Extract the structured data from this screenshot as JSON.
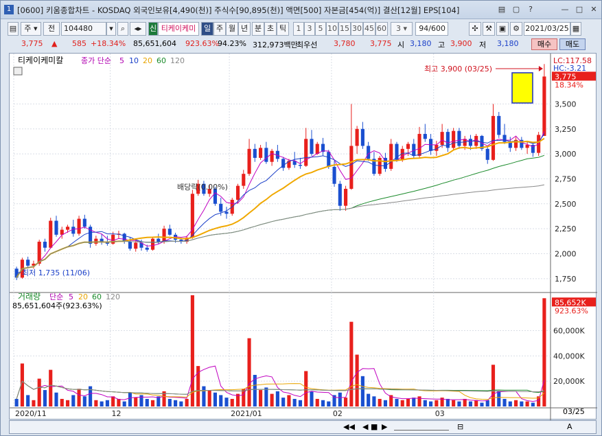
{
  "window": {
    "number": "1",
    "title": "[0600] 키움종합차트 - KOSDAQ 외국인보유[4,490(천)] 주식수[90,895(천)] 액면[500] 자본금[454(억)] 결산[12월] EPS[104]",
    "controls": [
      "▤",
      "▢",
      "?",
      "—",
      "□",
      "✕"
    ]
  },
  "toolbar": {
    "period": "주",
    "mode": "전",
    "code": "104480",
    "new_badge": "신",
    "stock_name": "티케이케미",
    "periods": [
      "일",
      "주",
      "월",
      "년",
      "분",
      "초",
      "틱"
    ],
    "selected_period": "일",
    "intervals": [
      "1",
      "3",
      "5",
      "10",
      "15",
      "30",
      "45",
      "60"
    ],
    "interval_value": "3",
    "count": "94/600",
    "date": "2021/03/25"
  },
  "quote": {
    "price": "3,775",
    "change_arrow": "▲",
    "change": "585",
    "change_pct": "+18.34%",
    "volume": "85,651,604",
    "volume_pct": "923.63%",
    "strength": "94.23%",
    "amount": "312,973백만",
    "priority_label": "최우선",
    "ask": "3,780",
    "bid": "3,775",
    "open_label": "시",
    "open": "3,180",
    "high_label": "고",
    "high": "3,900",
    "low_label": "저",
    "low": "3,180",
    "buy_label": "매수",
    "sell_label": "매도"
  },
  "price_panel": {
    "legend_name": "티케이케미칼",
    "legend_ma_label": "종가 단순",
    "legend_ma": [
      "5",
      "10",
      "20",
      "60",
      "120"
    ],
    "high_annotation": "최고 3,900 (03/25)",
    "low_annotation": "최저 1,735 (11/06)",
    "dividend_annotation": "배당락(0.00%)",
    "lc_label": "LC:117.58",
    "hc_label": "HC:-3.21",
    "last_price_label": "3,775",
    "last_pct_label": "18.34%"
  },
  "volume_panel": {
    "legend_name": "거래량",
    "legend_ma_label": "단순",
    "legend_ma": [
      "5",
      "20",
      "60",
      "120"
    ],
    "last_volume_text": "85,651,604주(923.63%)",
    "last_volume_label": "85,652K",
    "last_pct_label": "923.63%"
  },
  "x_axis_labels": [
    {
      "label": "2020/11",
      "index": 0
    },
    {
      "label": "12",
      "index": 17
    },
    {
      "label": "2021/01",
      "index": 38
    },
    {
      "label": "02",
      "index": 56
    },
    {
      "label": "03",
      "index": 74
    }
  ],
  "x_axis_end_label": "03/25",
  "chart_data": {
    "type": "candlestick",
    "price_axis": {
      "min": 1625,
      "max": 3950,
      "ticks": [
        1750,
        2000,
        2250,
        2500,
        2750,
        3000,
        3250,
        3500
      ]
    },
    "price_tick_labels": [
      "1,750",
      "2,000",
      "2,250",
      "2,500",
      "2,750",
      "3,000",
      "3,250",
      "3,500"
    ],
    "volume_axis": {
      "max": 88000,
      "ticks": [
        20000,
        40000,
        60000
      ]
    },
    "volume_tick_labels": [
      "20,000K",
      "40,000K",
      "60,000K"
    ],
    "ohlc": [
      [
        1850,
        1870,
        1735,
        1760
      ],
      [
        1760,
        1960,
        1750,
        1940
      ],
      [
        1940,
        1970,
        1860,
        1880
      ],
      [
        1880,
        1930,
        1850,
        1900
      ],
      [
        1900,
        2140,
        1880,
        2120
      ],
      [
        2120,
        2150,
        2020,
        2060
      ],
      [
        2060,
        2360,
        2050,
        2330
      ],
      [
        2330,
        2380,
        2170,
        2190
      ],
      [
        2190,
        2270,
        2150,
        2240
      ],
      [
        2240,
        2290,
        2210,
        2270
      ],
      [
        2270,
        2340,
        2170,
        2200
      ],
      [
        2200,
        2380,
        2180,
        2350
      ],
      [
        2350,
        2390,
        2250,
        2270
      ],
      [
        2270,
        2290,
        2060,
        2100
      ],
      [
        2100,
        2180,
        2080,
        2150
      ],
      [
        2150,
        2200,
        2090,
        2120
      ],
      [
        2120,
        2180,
        2080,
        2100
      ],
      [
        2100,
        2220,
        2090,
        2190
      ],
      [
        2190,
        2230,
        2150,
        2200
      ],
      [
        2200,
        2210,
        2100,
        2120
      ],
      [
        2120,
        2160,
        2030,
        2050
      ],
      [
        2050,
        2130,
        2020,
        2110
      ],
      [
        2110,
        2140,
        2030,
        2060
      ],
      [
        2060,
        2090,
        2020,
        2040
      ],
      [
        2040,
        2170,
        2030,
        2150
      ],
      [
        2150,
        2200,
        2100,
        2120
      ],
      [
        2120,
        2280,
        2100,
        2250
      ],
      [
        2250,
        2290,
        2180,
        2190
      ],
      [
        2190,
        2210,
        2110,
        2140
      ],
      [
        2140,
        2160,
        2100,
        2120
      ],
      [
        2120,
        2180,
        2100,
        2160
      ],
      [
        2160,
        2640,
        2150,
        2600
      ],
      [
        2600,
        2740,
        2580,
        2700
      ],
      [
        2700,
        2730,
        2580,
        2600
      ],
      [
        2600,
        2690,
        2570,
        2650
      ],
      [
        2650,
        2670,
        2480,
        2500
      ],
      [
        2500,
        2560,
        2380,
        2420
      ],
      [
        2420,
        2470,
        2350,
        2400
      ],
      [
        2400,
        2560,
        2380,
        2540
      ],
      [
        2540,
        2700,
        2500,
        2680
      ],
      [
        2680,
        2840,
        2650,
        2800
      ],
      [
        2800,
        3150,
        2780,
        3050
      ],
      [
        3050,
        3100,
        2920,
        2960
      ],
      [
        2960,
        3090,
        2940,
        3060
      ],
      [
        3060,
        3120,
        2900,
        2920
      ],
      [
        2920,
        3050,
        2880,
        3030
      ],
      [
        3030,
        3090,
        2920,
        2950
      ],
      [
        2950,
        2970,
        2830,
        2860
      ],
      [
        2860,
        2950,
        2840,
        2930
      ],
      [
        2930,
        3020,
        2860,
        2890
      ],
      [
        2890,
        2960,
        2850,
        2880
      ],
      [
        2880,
        3260,
        2870,
        3150
      ],
      [
        3150,
        3240,
        2980,
        3000
      ],
      [
        3000,
        3120,
        2990,
        3100
      ],
      [
        3100,
        3160,
        2980,
        3020
      ],
      [
        3020,
        3040,
        2850,
        2870
      ],
      [
        2870,
        2930,
        2670,
        2700
      ],
      [
        2700,
        2730,
        2430,
        2480
      ],
      [
        2480,
        2680,
        2430,
        2650
      ],
      [
        2650,
        3500,
        2640,
        3080
      ],
      [
        3080,
        3280,
        3000,
        3250
      ],
      [
        3250,
        3320,
        3050,
        3080
      ],
      [
        3080,
        3120,
        2930,
        2950
      ],
      [
        2950,
        3020,
        2780,
        2800
      ],
      [
        2800,
        2980,
        2780,
        2960
      ],
      [
        2960,
        3010,
        2820,
        2850
      ],
      [
        2850,
        3150,
        2830,
        3100
      ],
      [
        3100,
        3120,
        2920,
        2940
      ],
      [
        2940,
        3080,
        2920,
        3050
      ],
      [
        3050,
        3120,
        2980,
        3100
      ],
      [
        3100,
        3150,
        2960,
        2980
      ],
      [
        2980,
        3270,
        2960,
        3200
      ],
      [
        3200,
        3300,
        3120,
        3150
      ],
      [
        3150,
        3200,
        2990,
        3030
      ],
      [
        3030,
        3130,
        2980,
        3090
      ],
      [
        3090,
        3300,
        3060,
        3220
      ],
      [
        3220,
        3250,
        3020,
        3060
      ],
      [
        3060,
        3260,
        3040,
        3230
      ],
      [
        3230,
        3260,
        3050,
        3080
      ],
      [
        3080,
        3180,
        3040,
        3150
      ],
      [
        3150,
        3190,
        3040,
        3080
      ],
      [
        3080,
        3200,
        3050,
        3180
      ],
      [
        3180,
        3190,
        3030,
        3050
      ],
      [
        3050,
        3080,
        2900,
        2940
      ],
      [
        2940,
        3500,
        2930,
        3380
      ],
      [
        3380,
        3420,
        3160,
        3190
      ],
      [
        3190,
        3300,
        3100,
        3120
      ],
      [
        3120,
        3170,
        3020,
        3060
      ],
      [
        3060,
        3170,
        3030,
        3140
      ],
      [
        3140,
        3170,
        3040,
        3060
      ],
      [
        3060,
        3120,
        3000,
        3090
      ],
      [
        3090,
        3110,
        2970,
        3010
      ],
      [
        3010,
        3220,
        2980,
        3190
      ],
      [
        3180,
        3900,
        3180,
        3775
      ]
    ],
    "volume_k": [
      6000,
      34000,
      9000,
      5000,
      22000,
      13000,
      29000,
      11000,
      6000,
      5000,
      9000,
      14000,
      8000,
      16000,
      5000,
      4000,
      5000,
      8000,
      6000,
      4000,
      11000,
      7000,
      9000,
      6000,
      5000,
      8000,
      12000,
      6000,
      5000,
      4000,
      6000,
      88000,
      32000,
      16000,
      13000,
      11000,
      9000,
      7000,
      6000,
      10000,
      14000,
      54000,
      25000,
      13000,
      15000,
      10000,
      12000,
      7000,
      9000,
      6000,
      5000,
      28000,
      12000,
      6000,
      5000,
      4000,
      9000,
      11000,
      7000,
      67000,
      41000,
      24000,
      10000,
      8000,
      6000,
      5000,
      9000,
      6000,
      5000,
      6000,
      7000,
      8000,
      5000,
      4000,
      5000,
      7000,
      6000,
      5000,
      4000,
      6000,
      4000,
      5000,
      3000,
      5000,
      33000,
      12000,
      6000,
      4000,
      5000,
      4000,
      4000,
      3000,
      8000,
      85652
    ]
  }
}
